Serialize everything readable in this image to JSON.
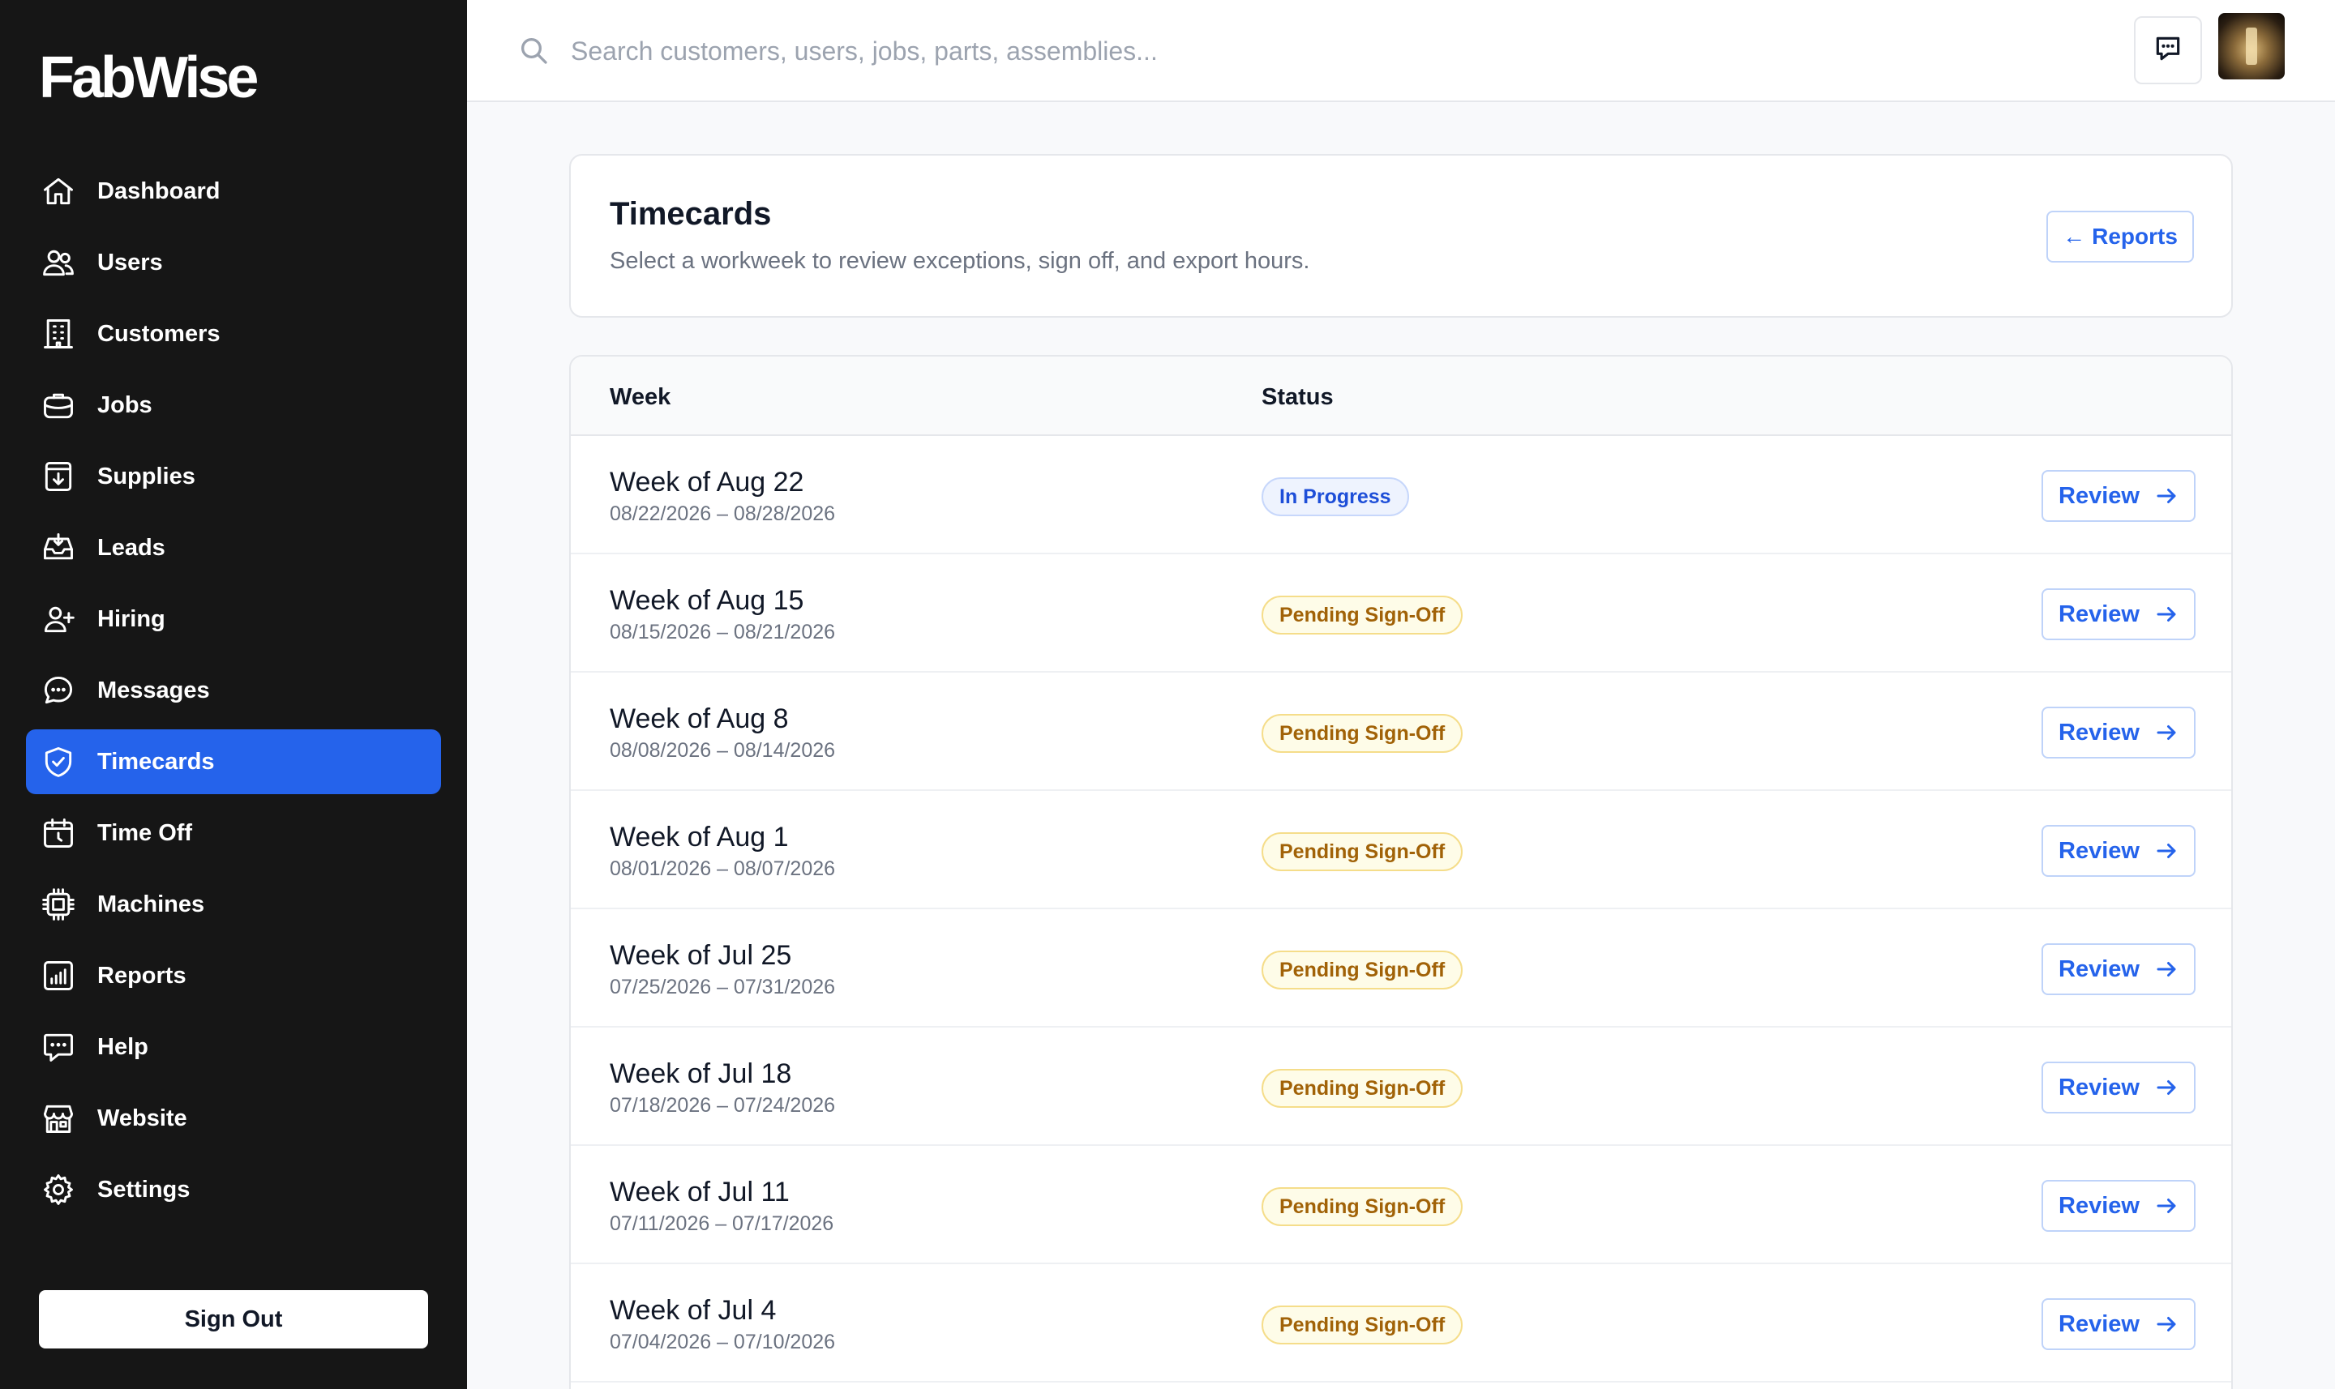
{
  "brand": {
    "name": "FabWise"
  },
  "sidebar": {
    "items": [
      {
        "label": "Dashboard",
        "icon": "home-icon",
        "active": false
      },
      {
        "label": "Users",
        "icon": "users-icon",
        "active": false
      },
      {
        "label": "Customers",
        "icon": "building-icon",
        "active": false
      },
      {
        "label": "Jobs",
        "icon": "briefcase-icon",
        "active": false
      },
      {
        "label": "Supplies",
        "icon": "archive-download-icon",
        "active": false
      },
      {
        "label": "Leads",
        "icon": "inbox-icon",
        "active": false
      },
      {
        "label": "Hiring",
        "icon": "user-plus-icon",
        "active": false
      },
      {
        "label": "Messages",
        "icon": "chat-bubble-icon",
        "active": false
      },
      {
        "label": "Timecards",
        "icon": "shield-check-icon",
        "active": true
      },
      {
        "label": "Time Off",
        "icon": "calendar-clock-icon",
        "active": false
      },
      {
        "label": "Machines",
        "icon": "cpu-chip-icon",
        "active": false
      },
      {
        "label": "Reports",
        "icon": "bar-chart-icon",
        "active": false
      },
      {
        "label": "Help",
        "icon": "help-chat-icon",
        "active": false
      },
      {
        "label": "Website",
        "icon": "storefront-icon",
        "active": false
      },
      {
        "label": "Settings",
        "icon": "gear-icon",
        "active": false
      }
    ],
    "sign_out_label": "Sign Out"
  },
  "topbar": {
    "search_placeholder": "Search customers, users, jobs, parts, assemblies...",
    "search_value": ""
  },
  "header": {
    "title": "Timecards",
    "subtitle": "Select a workweek to review exceptions, sign off, and export hours.",
    "reports_button": "Reports",
    "reports_arrow": "←"
  },
  "table": {
    "columns": {
      "week": "Week",
      "status": "Status"
    },
    "review_label": "Review",
    "rows": [
      {
        "title": "Week of Aug 22",
        "range": "08/22/2026 – 08/28/2026",
        "status": "In Progress",
        "status_color": "blue"
      },
      {
        "title": "Week of Aug 15",
        "range": "08/15/2026 – 08/21/2026",
        "status": "Pending Sign-Off",
        "status_color": "amber"
      },
      {
        "title": "Week of Aug 8",
        "range": "08/08/2026 – 08/14/2026",
        "status": "Pending Sign-Off",
        "status_color": "amber"
      },
      {
        "title": "Week of Aug 1",
        "range": "08/01/2026 – 08/07/2026",
        "status": "Pending Sign-Off",
        "status_color": "amber"
      },
      {
        "title": "Week of Jul 25",
        "range": "07/25/2026 – 07/31/2026",
        "status": "Pending Sign-Off",
        "status_color": "amber"
      },
      {
        "title": "Week of Jul 18",
        "range": "07/18/2026 – 07/24/2026",
        "status": "Pending Sign-Off",
        "status_color": "amber"
      },
      {
        "title": "Week of Jul 11",
        "range": "07/11/2026 – 07/17/2026",
        "status": "Pending Sign-Off",
        "status_color": "amber"
      },
      {
        "title": "Week of Jul 4",
        "range": "07/04/2026 – 07/10/2026",
        "status": "Pending Sign-Off",
        "status_color": "amber"
      }
    ]
  },
  "colors": {
    "sidebar_bg": "#161616",
    "accent": "#2563eb",
    "in_progress": "#1d4ed8",
    "pending": "#a16207"
  }
}
